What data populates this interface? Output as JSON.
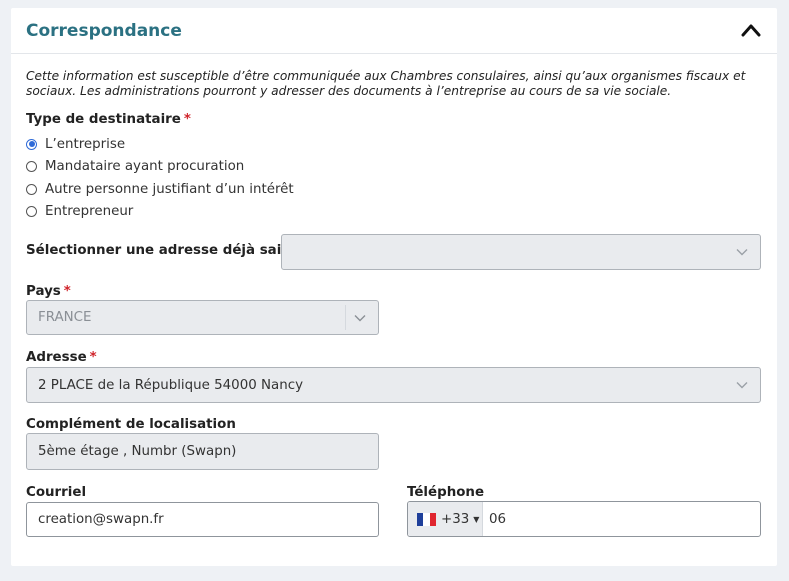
{
  "section": {
    "title": "Correspondance",
    "collapse_icon": "chevron-up-icon"
  },
  "info_text": "Cette information est susceptible d’être communiquée aux Chambres consulaires, ainsi qu’aux organismes fiscaux et sociaux. Les administrations pourront y adresser des documents à l’entreprise au cours de sa vie sociale.",
  "recipient_type": {
    "label": "Type de destinataire",
    "required_mark": "*",
    "options": [
      {
        "label": "L’entreprise",
        "checked": true
      },
      {
        "label": "Mandataire ayant procuration",
        "checked": false
      },
      {
        "label": "Autre personne justifiant d’un intérêt",
        "checked": false
      },
      {
        "label": "Entrepreneur",
        "checked": false
      }
    ]
  },
  "saved_address": {
    "label": "Sélectionner une adresse déjà saisie :",
    "value": ""
  },
  "country": {
    "label": "Pays",
    "required_mark": "*",
    "value": "FRANCE"
  },
  "address": {
    "label": "Adresse",
    "required_mark": "*",
    "value": "2 PLACE de la République 54000 Nancy"
  },
  "location_complement": {
    "label": "Complément de localisation",
    "value": "5ème étage , Numbr (Swapn)"
  },
  "email": {
    "label": "Courriel",
    "value": "creation@swapn.fr"
  },
  "phone": {
    "label": "Téléphone",
    "country_code": "+33",
    "value": "06",
    "flag_colors": [
      "#1f3f9a",
      "#ffffff",
      "#e0262f"
    ]
  }
}
